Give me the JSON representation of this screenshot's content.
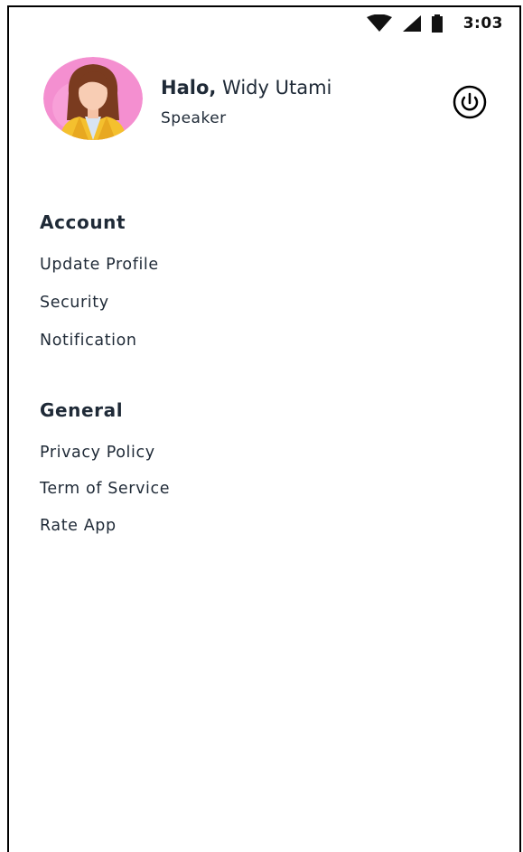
{
  "status_bar": {
    "time": "3:03",
    "icons": [
      "wifi-icon",
      "cellular-signal-icon",
      "battery-icon"
    ]
  },
  "profile": {
    "greeting_prefix": "Halo,",
    "name": "Widy Utami",
    "role": "Speaker",
    "avatar_icon": "woman-avatar",
    "logout_icon": "power-icon"
  },
  "menu": {
    "account": {
      "title": "Account",
      "items": [
        {
          "label": "Update Profile"
        },
        {
          "label": "Security"
        },
        {
          "label": "Notification"
        }
      ]
    },
    "general": {
      "title": "General",
      "items": [
        {
          "label": "Privacy Policy"
        },
        {
          "label": "Term of Service"
        },
        {
          "label": "Rate App"
        }
      ]
    }
  },
  "colors": {
    "text": "#1f2a37",
    "avatar_bg": "#f48fd0",
    "hair": "#7a3b1f",
    "jacket": "#f4c02e"
  }
}
